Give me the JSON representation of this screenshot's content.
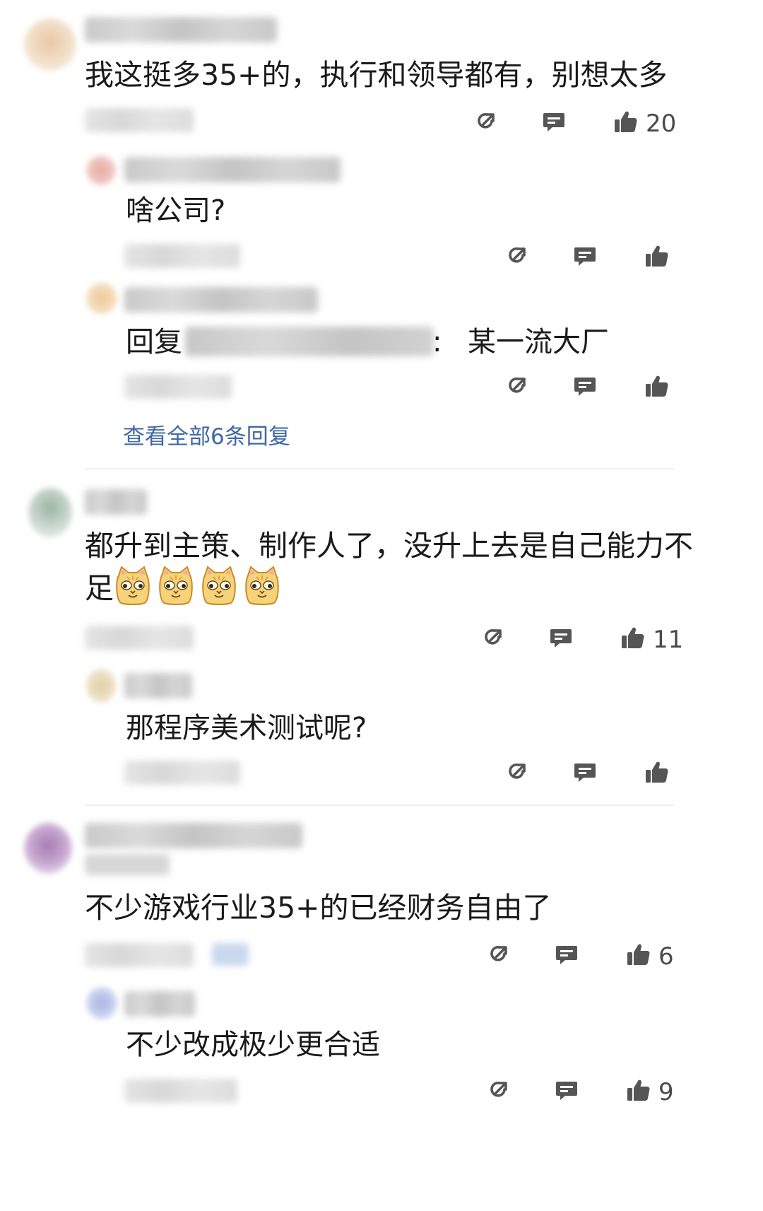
{
  "comments": [
    {
      "text": "我这挺多35+的，执行和领导都有，别想太多",
      "likes": "20",
      "replies": [
        {
          "text": "啥公司?"
        },
        {
          "reply_prefix": "回复",
          "separator": ":",
          "text": "某一流大厂"
        }
      ],
      "view_all": "查看全部6条回复"
    },
    {
      "text_line1": "都升到主策、制作人了，没升上去是自己能力不",
      "text_line2": "足",
      "emoji_count": 4,
      "likes": "11",
      "replies": [
        {
          "text": "那程序美术测试呢?"
        }
      ]
    },
    {
      "text": "不少游戏行业35+的已经财务自由了",
      "likes": "6",
      "replies": [
        {
          "text": "不少改成极少更合适",
          "likes": "9"
        }
      ]
    }
  ],
  "icons": {
    "share": "share-icon",
    "reply": "comment-icon",
    "like": "thumbs-up-icon"
  },
  "colors": {
    "link": "#3f68a6",
    "icon": "#555555"
  }
}
